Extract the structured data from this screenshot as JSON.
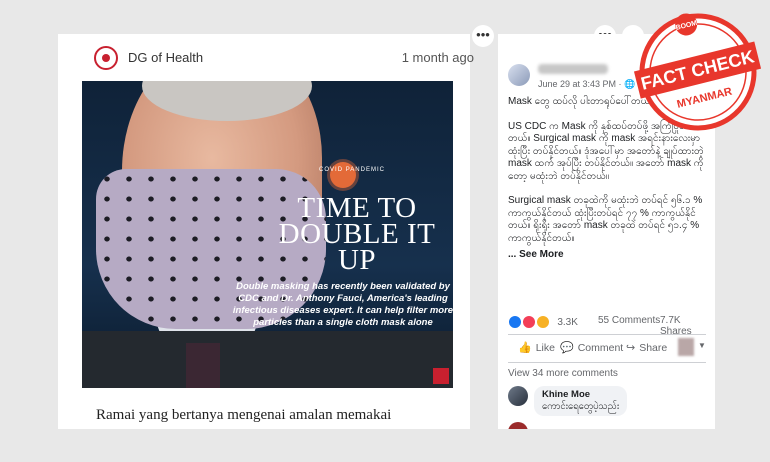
{
  "left_post": {
    "author": "DG of Health",
    "time": "1 month ago",
    "image": {
      "badge": "COVID PANDEMIC",
      "headline": "TIME TO DOUBLE IT UP",
      "body": "Double masking has recently been validated by CDC and Dr. Anthony Fauci, America's leading infectious diseases expert. It can help filter more particles than a single cloth mask alone"
    },
    "caption": "Ramai yang bertanya mengenai amalan memakai"
  },
  "right_post": {
    "date": "June 29 at 3:43 PM · ",
    "paragraphs": [
      "Mask တွေ ထပ်လို ပါးတာရုပ်ပေါ်တယ် မလုပ်သင့်ဘူး။",
      "US CDC က Mask ကို နှစ်ထပ်တပ်ဖို့ အကြံပြုထားတယ်။ Surgical mask ကို mask အရင်းနားလေးမှာ ထုံးပြီး တပ်နိုင်တယ်။ ဒုံအပေါ်မှာ အတော်နဲ့ ချုပ်ထားတဲ့ mask ထက် အုပ်ပြီး တပ်နိုင်တယ်။ အတော် mask ကိုတော့ မထုံးဘဲ တပ်နိုင်တယ်။",
      "Surgical mask တခုထဲကို မထုံးဘဲ တပ်ရင် ၅၆.၁ % ကာကွယ်နိုင်တယ် ထုံးပြီးတပ်ရင် ၇၇ % ကာကွယ်နိုင်တယ်။ ရိုးရိုး အတော် mask တခုထဲ တပ်ရင် ၅၁.၄ % ကာကွယ်နိုင်တယ်။"
    ],
    "see_more": "... See More",
    "reactions_count": "3.3K",
    "comments_count": "55 Comments",
    "shares_count": "7.7K Shares",
    "actions": {
      "like": "Like",
      "comment": "Comment",
      "share": "Share"
    },
    "view_more": "View 34 more comments",
    "comment": {
      "author": "Khine Moe",
      "text": "ကောင်းရေတွေပဲ့သည်း"
    }
  },
  "topbar": {
    "icon1": "•••",
    "icon2": "→",
    "icon3": "•••"
  },
  "stamp": {
    "top": "BOOM",
    "main": "FACT CHECK",
    "bottom": "MYANMAR"
  },
  "colors": {
    "stamp_red": "#e8372c",
    "fb_blue": "#1877f2"
  }
}
